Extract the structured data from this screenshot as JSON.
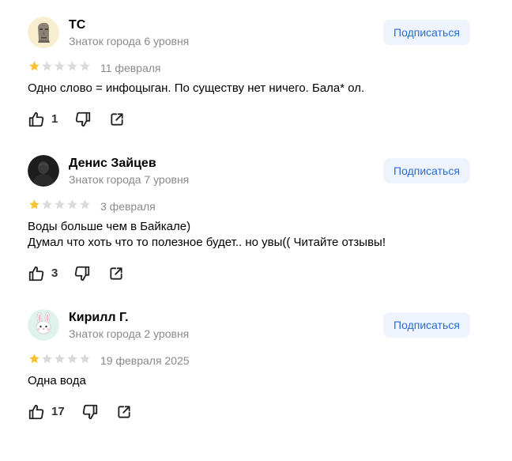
{
  "reviews": [
    {
      "author_name": "ТС",
      "author_level": "Знаток города 6 уровня",
      "avatar_icon": "moai-icon",
      "subscribe_label": "Подписаться",
      "rating": 1,
      "rating_max": 5,
      "date": "11 февраля",
      "text_lines": [
        "Одно слово = инфоцыган. По существу нет ничего. Бала* ол."
      ],
      "likes": "1"
    },
    {
      "author_name": "Денис Зайцев",
      "author_level": "Знаток города 7 уровня",
      "avatar_icon": "person-photo-avatar",
      "subscribe_label": "Подписаться",
      "rating": 1,
      "rating_max": 5,
      "date": "3 февраля",
      "text_lines": [
        "Воды больше чем в Байкале)",
        "Думал что хоть что то полезное будет.. но увы(( Читайте отзывы!"
      ],
      "likes": "3"
    },
    {
      "author_name": "Кирилл Г.",
      "author_level": "Знаток города 2 уровня",
      "avatar_icon": "rabbit-face-icon",
      "subscribe_label": "Подписаться",
      "rating": 1,
      "rating_max": 5,
      "date": "19 февраля 2025",
      "text_lines": [
        "Одна вода"
      ],
      "likes": "17"
    }
  ],
  "icons": {
    "like": "thumbs-up-icon",
    "dislike": "thumbs-down-icon",
    "share": "share-icon",
    "star": "star-icon"
  },
  "colors": {
    "star_filled": "#fbc02d",
    "star_empty": "#d9d9d9",
    "subscribe_bg": "#eef3fc",
    "subscribe_text": "#2c6ed6",
    "secondary_text": "#8a8a8a"
  }
}
